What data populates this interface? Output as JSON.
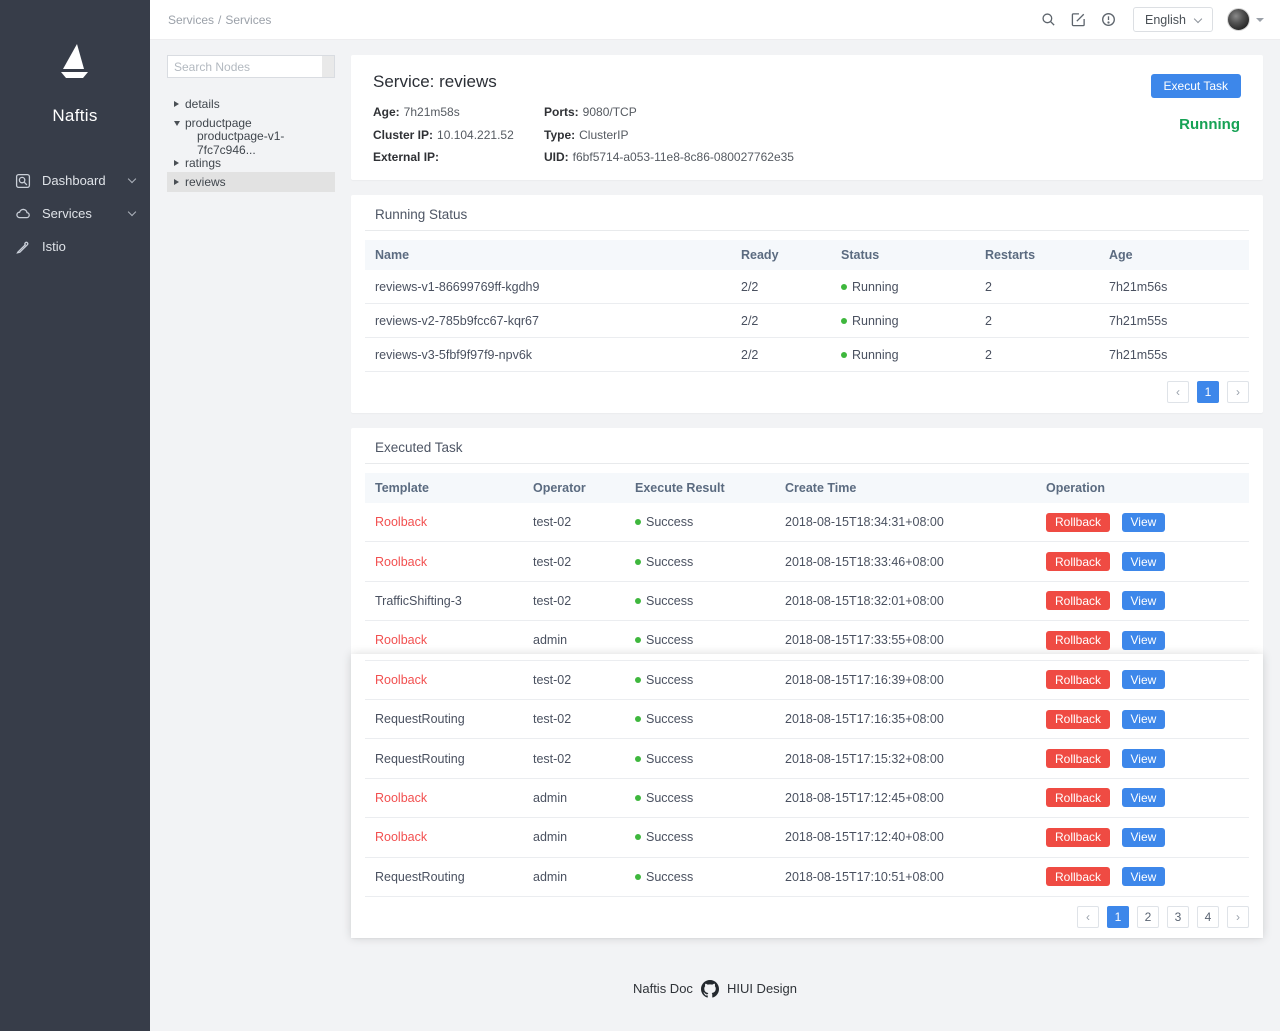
{
  "colors": {
    "accent_blue": "#3d87ea",
    "danger_red": "#ef4b43",
    "danger_text": "#f25050",
    "running_green": "#16a255",
    "status_dot_green": "#3eb73d",
    "sidebar_bg": "#373d49",
    "page_bg": "#f2f3f5"
  },
  "topbar": {
    "breadcrumb": {
      "parent": "Services",
      "separator": "/",
      "current": "Services"
    },
    "language": "English"
  },
  "sidebar": {
    "brand": "Naftis",
    "items": [
      {
        "label": "Dashboard"
      },
      {
        "label": "Services"
      },
      {
        "label": "Istio"
      }
    ]
  },
  "tree": {
    "search_placeholder": "Search Nodes",
    "nodes": [
      {
        "label": "details"
      },
      {
        "label": "productpage"
      },
      {
        "label": "productpage-v1-7fc7c946..."
      },
      {
        "label": "ratings"
      },
      {
        "label": "reviews"
      }
    ]
  },
  "service": {
    "title": "Service: reviews",
    "execute_button": "Execut Task",
    "status": "Running",
    "fields": {
      "age_label": "Age:",
      "age": "7h21m58s",
      "ports_label": "Ports:",
      "ports": "9080/TCP",
      "cluster_ip_label": "Cluster IP:",
      "cluster_ip": "10.104.221.52",
      "type_label": "Type:",
      "type": "ClusterIP",
      "external_ip_label": "External IP:",
      "external_ip": "",
      "uid_label": "UID:",
      "uid": "f6bf5714-a053-11e8-8c86-080027762e35"
    }
  },
  "running_status": {
    "title": "Running Status",
    "columns": {
      "name": "Name",
      "ready": "Ready",
      "status": "Status",
      "restarts": "Restarts",
      "age": "Age"
    },
    "rows": [
      {
        "name": "reviews-v1-86699769ff-kgdh9",
        "ready": "2/2",
        "status": "Running",
        "restarts": "2",
        "age": "7h21m56s"
      },
      {
        "name": "reviews-v2-785b9fcc67-kqr67",
        "ready": "2/2",
        "status": "Running",
        "restarts": "2",
        "age": "7h21m55s"
      },
      {
        "name": "reviews-v3-5fbf9f97f9-npv6k",
        "ready": "2/2",
        "status": "Running",
        "restarts": "2",
        "age": "7h21m55s"
      }
    ],
    "pagination": {
      "page": "1",
      "active": "1"
    }
  },
  "executed_task": {
    "title": "Executed Task",
    "columns": {
      "template": "Template",
      "operator": "Operator",
      "result": "Execute Result",
      "time": "Create Time",
      "operation": "Operation"
    },
    "buttons": {
      "rollback": "Rollback",
      "view": "View"
    },
    "rows": [
      {
        "template": "Roolback",
        "danger": true,
        "operator": "test-02",
        "result": "Success",
        "time": "2018-08-15T18:34:31+08:00"
      },
      {
        "template": "Roolback",
        "danger": true,
        "operator": "test-02",
        "result": "Success",
        "time": "2018-08-15T18:33:46+08:00"
      },
      {
        "template": "TrafficShifting-3",
        "danger": false,
        "operator": "test-02",
        "result": "Success",
        "time": "2018-08-15T18:32:01+08:00"
      },
      {
        "template": "Roolback",
        "danger": true,
        "operator": "admin",
        "result": "Success",
        "time": "2018-08-15T17:33:55+08:00"
      },
      {
        "template": "Roolback",
        "danger": true,
        "operator": "test-02",
        "result": "Success",
        "time": "2018-08-15T17:16:39+08:00"
      },
      {
        "template": "RequestRouting",
        "danger": false,
        "operator": "test-02",
        "result": "Success",
        "time": "2018-08-15T17:16:35+08:00"
      },
      {
        "template": "RequestRouting",
        "danger": false,
        "operator": "test-02",
        "result": "Success",
        "time": "2018-08-15T17:15:32+08:00"
      },
      {
        "template": "Roolback",
        "danger": true,
        "operator": "admin",
        "result": "Success",
        "time": "2018-08-15T17:12:45+08:00"
      },
      {
        "template": "Roolback",
        "danger": true,
        "operator": "admin",
        "result": "Success",
        "time": "2018-08-15T17:12:40+08:00"
      },
      {
        "template": "RequestRouting",
        "danger": false,
        "operator": "admin",
        "result": "Success",
        "time": "2018-08-15T17:10:51+08:00"
      }
    ],
    "pagination": {
      "pages": [
        "1",
        "2",
        "3",
        "4"
      ],
      "active": "1"
    }
  },
  "footer": {
    "doc": "Naftis Doc",
    "design": "HIUI Design"
  }
}
